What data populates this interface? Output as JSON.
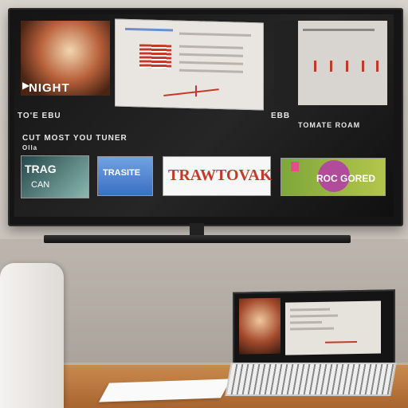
{
  "tv": {
    "hero_title": "NIGHT",
    "hero_play_icon": "play-icon",
    "heading_left": "TO'E EBU",
    "heading_right": "EBB",
    "heading_right_sub": "TOMATE ROAM",
    "section_label": "CUT MOST YOU TUNER",
    "section_sub": "Olla",
    "tiles": [
      {
        "title": "TRAG",
        "subtitle": "CAN"
      },
      {
        "title": "TRASITE"
      },
      {
        "title": "TRAWTOVAK"
      },
      {
        "title": "ROC GORED"
      }
    ]
  },
  "colors": {
    "accent_red": "#c43a2a",
    "screen_bg": "#1a1a1a",
    "tile_green": "#8fb14a",
    "tile_blue": "#4f86d6"
  }
}
